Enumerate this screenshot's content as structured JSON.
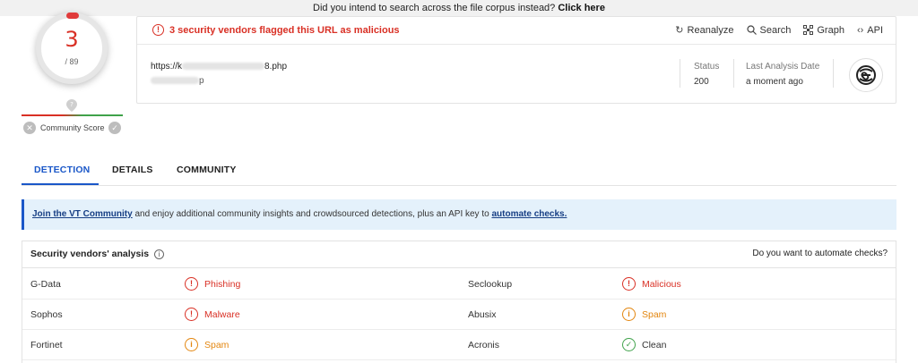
{
  "topbar": {
    "text": "Did you intend to search across the file corpus instead?",
    "link": "Click here"
  },
  "score": {
    "detections": "3",
    "total": "/ 89",
    "community_label": "Community Score"
  },
  "header": {
    "flag_text": "3 security vendors flagged this URL as malicious",
    "actions": [
      {
        "label": "Reanalyze",
        "icon": "refresh-icon"
      },
      {
        "label": "Search",
        "icon": "search-icon"
      },
      {
        "label": "Graph",
        "icon": "graph-icon"
      },
      {
        "label": "API",
        "icon": "api-icon"
      }
    ],
    "url_prefix": "https://k",
    "url_suffix": "8.php",
    "host_suffix": "p",
    "status_label": "Status",
    "status_value": "200",
    "date_label": "Last Analysis Date",
    "date_value": "a moment ago"
  },
  "tabs": [
    {
      "label": "DETECTION"
    },
    {
      "label": "DETAILS"
    },
    {
      "label": "COMMUNITY"
    }
  ],
  "banner": {
    "link1": "Join the VT Community",
    "text": " and enjoy additional community insights and crowdsourced detections, plus an API key to ",
    "link2": "automate checks."
  },
  "vendors": {
    "title": "Security vendors' analysis",
    "automate": "Do you want to automate checks?",
    "rows": [
      {
        "v1": "G-Data",
        "r1": "Phishing",
        "v2": "Seclookup",
        "r2": "Malicious"
      },
      {
        "v1": "Sophos",
        "r1": "Malware",
        "v2": "Abusix",
        "r2": "Spam"
      },
      {
        "v1": "Fortinet",
        "r1": "Spam",
        "v2": "Acronis",
        "r2": "Clean"
      }
    ]
  },
  "colors": {
    "malicious": "#d93025",
    "suspicious": "#e3860f",
    "clean": "#3fa24a",
    "accent": "#1a57c8"
  }
}
